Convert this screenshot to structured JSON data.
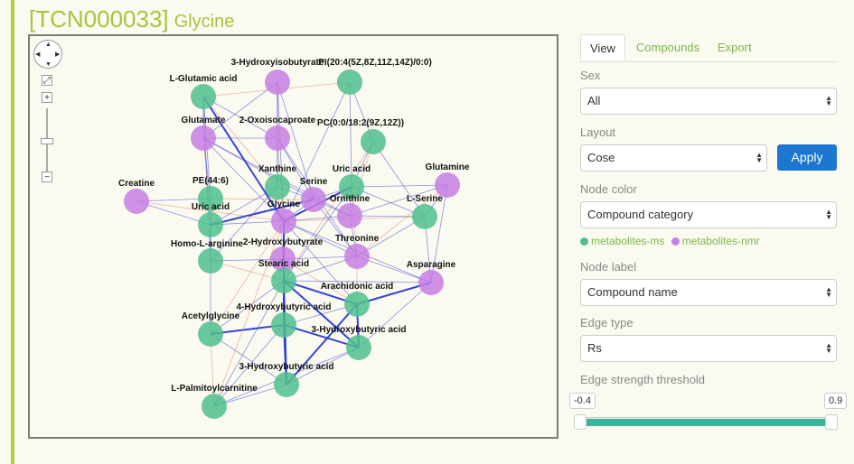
{
  "page": {
    "id": "[TCN000033]",
    "name": "Glycine"
  },
  "controls": {
    "pan": "pan-control",
    "fit": "⤢",
    "zoom_in": "+",
    "zoom_out": "−"
  },
  "colors": {
    "ms": "#4fbf8d",
    "nmr": "#c57ee3",
    "edge_pos": "#2b3bd6",
    "edge_neg": "#e07a5f",
    "accent": "#a8c43c"
  },
  "tabs": [
    {
      "label": "View",
      "active": true
    },
    {
      "label": "Compounds",
      "active": false
    },
    {
      "label": "Export",
      "active": false
    }
  ],
  "sex": {
    "label": "Sex",
    "value": "All"
  },
  "layout": {
    "label": "Layout",
    "value": "Cose",
    "apply_label": "Apply"
  },
  "node_color": {
    "label": "Node color",
    "value": "Compound category"
  },
  "legend": [
    {
      "label": "metabolites-ms",
      "color": "#4fbf8d"
    },
    {
      "label": "metabolites-nmr",
      "color": "#c57ee3"
    }
  ],
  "node_label": {
    "label": "Node label",
    "value": "Compound name"
  },
  "edge_type": {
    "label": "Edge type",
    "value": "Rs"
  },
  "threshold": {
    "label": "Edge strength threshold",
    "min": "-0.4",
    "max": "0.9",
    "low_value": -0.4,
    "high_value": 0.9
  },
  "graph": {
    "nodes": [
      {
        "id": "glu",
        "label": "L-Glutamic acid",
        "cat": "ms"
      },
      {
        "id": "hib",
        "label": "3-Hydroxyisobutyrate",
        "cat": "nmr"
      },
      {
        "id": "pi",
        "label": "PI(20:4(5Z,8Z,11Z,14Z)/0:0)",
        "cat": "ms"
      },
      {
        "id": "glutamate",
        "label": "Glutamate",
        "cat": "nmr"
      },
      {
        "id": "oxo",
        "label": "2-Oxoisocaproate",
        "cat": "nmr"
      },
      {
        "id": "pc",
        "label": "PC(0:0/18:2(9Z,12Z))",
        "cat": "ms"
      },
      {
        "id": "creatine",
        "label": "Creatine",
        "cat": "nmr"
      },
      {
        "id": "xanthine",
        "label": "Xanthine",
        "cat": "ms"
      },
      {
        "id": "uric1",
        "label": "Uric acid",
        "cat": "ms"
      },
      {
        "id": "glutamine",
        "label": "Glutamine",
        "cat": "nmr"
      },
      {
        "id": "pe",
        "label": "PE(44:6)",
        "cat": "ms"
      },
      {
        "id": "serine",
        "label": "Serine",
        "cat": "nmr"
      },
      {
        "id": "ornithine",
        "label": "Ornithine",
        "cat": "nmr"
      },
      {
        "id": "lserine",
        "label": "L-Serine",
        "cat": "ms"
      },
      {
        "id": "uric2",
        "label": "Uric acid",
        "cat": "ms"
      },
      {
        "id": "glycine",
        "label": "Glycine",
        "cat": "nmr"
      },
      {
        "id": "homoarg",
        "label": "Homo-L-arginine",
        "cat": "ms"
      },
      {
        "id": "hb2",
        "label": "2-Hydroxybutyrate",
        "cat": "nmr"
      },
      {
        "id": "threonine",
        "label": "Threonine",
        "cat": "nmr"
      },
      {
        "id": "stearic",
        "label": "Stearic acid",
        "cat": "ms"
      },
      {
        "id": "asparagine",
        "label": "Asparagine",
        "cat": "nmr"
      },
      {
        "id": "arach",
        "label": "Arachidonic acid",
        "cat": "ms"
      },
      {
        "id": "hb4",
        "label": "4-Hydroxybutyric acid",
        "cat": "ms"
      },
      {
        "id": "acetylgly",
        "label": "Acetylglycine",
        "cat": "ms"
      },
      {
        "id": "hb3a",
        "label": "3-Hydroxybutyric acid",
        "cat": "ms"
      },
      {
        "id": "hb3b",
        "label": "3-Hydroxybutyric acid",
        "cat": "ms"
      },
      {
        "id": "palm",
        "label": "L-Palmitoylcarnitine",
        "cat": "ms"
      }
    ],
    "edges": [
      {
        "s": "glu",
        "t": "glycine",
        "sign": "pos",
        "strong": true
      },
      {
        "s": "glycine",
        "t": "stearic",
        "sign": "pos",
        "strong": true
      },
      {
        "s": "stearic",
        "t": "hb4",
        "sign": "pos",
        "strong": true
      },
      {
        "s": "stearic",
        "t": "arach",
        "sign": "pos",
        "strong": true
      },
      {
        "s": "stearic",
        "t": "hb3a",
        "sign": "pos",
        "strong": true
      },
      {
        "s": "stearic",
        "t": "hb3b",
        "sign": "pos",
        "strong": true
      },
      {
        "s": "arach",
        "t": "hb3a",
        "sign": "pos",
        "strong": true
      },
      {
        "s": "arach",
        "t": "hb3b",
        "sign": "pos",
        "strong": true
      },
      {
        "s": "hb4",
        "t": "hb3b",
        "sign": "pos",
        "strong": true
      },
      {
        "s": "arach",
        "t": "asparagine",
        "sign": "pos",
        "strong": true
      },
      {
        "s": "glycine",
        "t": "uric1",
        "sign": "pos",
        "strong": true
      },
      {
        "s": "uric2",
        "t": "serine",
        "sign": "pos",
        "strong": true
      },
      {
        "s": "acetylgly",
        "t": "hb4",
        "sign": "pos",
        "strong": true
      },
      {
        "s": "hb3a",
        "t": "hb4",
        "sign": "pos",
        "strong": true
      },
      {
        "s": "glycine",
        "t": "hb2",
        "sign": "pos",
        "strong": false
      },
      {
        "s": "hib",
        "t": "glutamate",
        "sign": "pos",
        "strong": false
      },
      {
        "s": "hib",
        "t": "oxo",
        "sign": "pos",
        "strong": false
      },
      {
        "s": "hib",
        "t": "xanthine",
        "sign": "pos",
        "strong": false
      },
      {
        "s": "hib",
        "t": "serine",
        "sign": "pos",
        "strong": false
      },
      {
        "s": "hib",
        "t": "glycine",
        "sign": "pos",
        "strong": false
      },
      {
        "s": "pi",
        "t": "pc",
        "sign": "pos",
        "strong": false
      },
      {
        "s": "pi",
        "t": "uric1",
        "sign": "pos",
        "strong": false
      },
      {
        "s": "pi",
        "t": "glycine",
        "sign": "pos",
        "strong": false
      },
      {
        "s": "pi",
        "t": "glu",
        "sign": "neg",
        "strong": false
      },
      {
        "s": "glutamate",
        "t": "oxo",
        "sign": "pos",
        "strong": false
      },
      {
        "s": "glutamate",
        "t": "serine",
        "sign": "pos",
        "strong": false
      },
      {
        "s": "glutamate",
        "t": "pe",
        "sign": "pos",
        "strong": false
      },
      {
        "s": "glutamate",
        "t": "ornithine",
        "sign": "pos",
        "strong": false
      },
      {
        "s": "glutamate",
        "t": "glycine",
        "sign": "pos",
        "strong": false
      },
      {
        "s": "glutamate",
        "t": "uric2",
        "sign": "neg",
        "strong": false
      },
      {
        "s": "oxo",
        "t": "xanthine",
        "sign": "pos",
        "strong": false
      },
      {
        "s": "oxo",
        "t": "serine",
        "sign": "pos",
        "strong": false
      },
      {
        "s": "oxo",
        "t": "threonine",
        "sign": "pos",
        "strong": false
      },
      {
        "s": "oxo",
        "t": "glycine",
        "sign": "neg",
        "strong": false
      },
      {
        "s": "pc",
        "t": "uric1",
        "sign": "pos",
        "strong": false
      },
      {
        "s": "pc",
        "t": "lserine",
        "sign": "pos",
        "strong": false
      },
      {
        "s": "pc",
        "t": "ornithine",
        "sign": "neg",
        "strong": false
      },
      {
        "s": "pc",
        "t": "stearic",
        "sign": "neg",
        "strong": false
      },
      {
        "s": "creatine",
        "t": "pe",
        "sign": "pos",
        "strong": false
      },
      {
        "s": "creatine",
        "t": "uric2",
        "sign": "pos",
        "strong": false
      },
      {
        "s": "creatine",
        "t": "glycine",
        "sign": "neg",
        "strong": false
      },
      {
        "s": "xanthine",
        "t": "serine",
        "sign": "pos",
        "strong": false
      },
      {
        "s": "xanthine",
        "t": "uric2",
        "sign": "pos",
        "strong": false
      },
      {
        "s": "xanthine",
        "t": "homoarg",
        "sign": "pos",
        "strong": false
      },
      {
        "s": "xanthine",
        "t": "hb2",
        "sign": "neg",
        "strong": false
      },
      {
        "s": "uric1",
        "t": "serine",
        "sign": "pos",
        "strong": false
      },
      {
        "s": "uric1",
        "t": "ornithine",
        "sign": "pos",
        "strong": false
      },
      {
        "s": "uric1",
        "t": "lserine",
        "sign": "pos",
        "strong": false
      },
      {
        "s": "uric1",
        "t": "threonine",
        "sign": "neg",
        "strong": false
      },
      {
        "s": "glutamine",
        "t": "lserine",
        "sign": "pos",
        "strong": false
      },
      {
        "s": "glutamine",
        "t": "ornithine",
        "sign": "pos",
        "strong": false
      },
      {
        "s": "glutamine",
        "t": "asparagine",
        "sign": "pos",
        "strong": false
      },
      {
        "s": "glutamine",
        "t": "threonine",
        "sign": "neg",
        "strong": false
      },
      {
        "s": "pe",
        "t": "uric2",
        "sign": "pos",
        "strong": false
      },
      {
        "s": "pe",
        "t": "homoarg",
        "sign": "pos",
        "strong": false
      },
      {
        "s": "pe",
        "t": "serine",
        "sign": "neg",
        "strong": false
      },
      {
        "s": "serine",
        "t": "ornithine",
        "sign": "pos",
        "strong": false
      },
      {
        "s": "serine",
        "t": "glycine",
        "sign": "pos",
        "strong": false
      },
      {
        "s": "serine",
        "t": "threonine",
        "sign": "pos",
        "strong": false
      },
      {
        "s": "ornithine",
        "t": "lserine",
        "sign": "pos",
        "strong": false
      },
      {
        "s": "ornithine",
        "t": "threonine",
        "sign": "pos",
        "strong": false
      },
      {
        "s": "ornithine",
        "t": "glycine",
        "sign": "pos",
        "strong": false
      },
      {
        "s": "lserine",
        "t": "threonine",
        "sign": "pos",
        "strong": false
      },
      {
        "s": "lserine",
        "t": "asparagine",
        "sign": "pos",
        "strong": false
      },
      {
        "s": "uric2",
        "t": "glycine",
        "sign": "pos",
        "strong": false
      },
      {
        "s": "uric2",
        "t": "homoarg",
        "sign": "pos",
        "strong": false
      },
      {
        "s": "homoarg",
        "t": "hb2",
        "sign": "pos",
        "strong": false
      },
      {
        "s": "homoarg",
        "t": "acetylgly",
        "sign": "pos",
        "strong": false
      },
      {
        "s": "homoarg",
        "t": "stearic",
        "sign": "neg",
        "strong": false
      },
      {
        "s": "hb2",
        "t": "threonine",
        "sign": "pos",
        "strong": false
      },
      {
        "s": "hb2",
        "t": "stearic",
        "sign": "pos",
        "strong": false
      },
      {
        "s": "hb2",
        "t": "arach",
        "sign": "neg",
        "strong": false
      },
      {
        "s": "threonine",
        "t": "asparagine",
        "sign": "pos",
        "strong": false
      },
      {
        "s": "threonine",
        "t": "arach",
        "sign": "neg",
        "strong": false
      },
      {
        "s": "threonine",
        "t": "stearic",
        "sign": "pos",
        "strong": false
      },
      {
        "s": "stearic",
        "t": "asparagine",
        "sign": "pos",
        "strong": false
      },
      {
        "s": "arach",
        "t": "hb4",
        "sign": "pos",
        "strong": false
      },
      {
        "s": "hb4",
        "t": "palm",
        "sign": "pos",
        "strong": false
      },
      {
        "s": "hb4",
        "t": "acetylgly",
        "sign": "pos",
        "strong": false
      },
      {
        "s": "acetylgly",
        "t": "stearic",
        "sign": "pos",
        "strong": false
      },
      {
        "s": "acetylgly",
        "t": "hb3b",
        "sign": "pos",
        "strong": false
      },
      {
        "s": "acetylgly",
        "t": "palm",
        "sign": "neg",
        "strong": false
      },
      {
        "s": "hb3a",
        "t": "palm",
        "sign": "pos",
        "strong": false
      },
      {
        "s": "hb3a",
        "t": "hb3b",
        "sign": "pos",
        "strong": false
      },
      {
        "s": "hb3a",
        "t": "asparagine",
        "sign": "pos",
        "strong": false
      },
      {
        "s": "hb3b",
        "t": "palm",
        "sign": "pos",
        "strong": false
      },
      {
        "s": "palm",
        "t": "stearic",
        "sign": "pos",
        "strong": false
      },
      {
        "s": "palm",
        "t": "glycine",
        "sign": "neg",
        "strong": false
      },
      {
        "s": "glu",
        "t": "glutamate",
        "sign": "pos",
        "strong": false
      },
      {
        "s": "glu",
        "t": "pe",
        "sign": "pos",
        "strong": false
      },
      {
        "s": "glu",
        "t": "xanthine",
        "sign": "neg",
        "strong": false
      },
      {
        "s": "glu",
        "t": "homoarg",
        "sign": "pos",
        "strong": false
      },
      {
        "s": "glu",
        "t": "oxo",
        "sign": "pos",
        "strong": false
      },
      {
        "s": "glycine",
        "t": "asparagine",
        "sign": "pos",
        "strong": false
      },
      {
        "s": "glycine",
        "t": "arach",
        "sign": "pos",
        "strong": false
      },
      {
        "s": "glycine",
        "t": "hb4",
        "sign": "pos",
        "strong": false
      },
      {
        "s": "glycine",
        "t": "acetylgly",
        "sign": "neg",
        "strong": false
      },
      {
        "s": "glycine",
        "t": "threonine",
        "sign": "pos",
        "strong": false
      },
      {
        "s": "glycine",
        "t": "lserine",
        "sign": "neg",
        "strong": false
      },
      {
        "s": "uric1",
        "t": "stearic",
        "sign": "pos",
        "strong": false
      },
      {
        "s": "uric1",
        "t": "glutamine",
        "sign": "pos",
        "strong": false
      }
    ]
  }
}
